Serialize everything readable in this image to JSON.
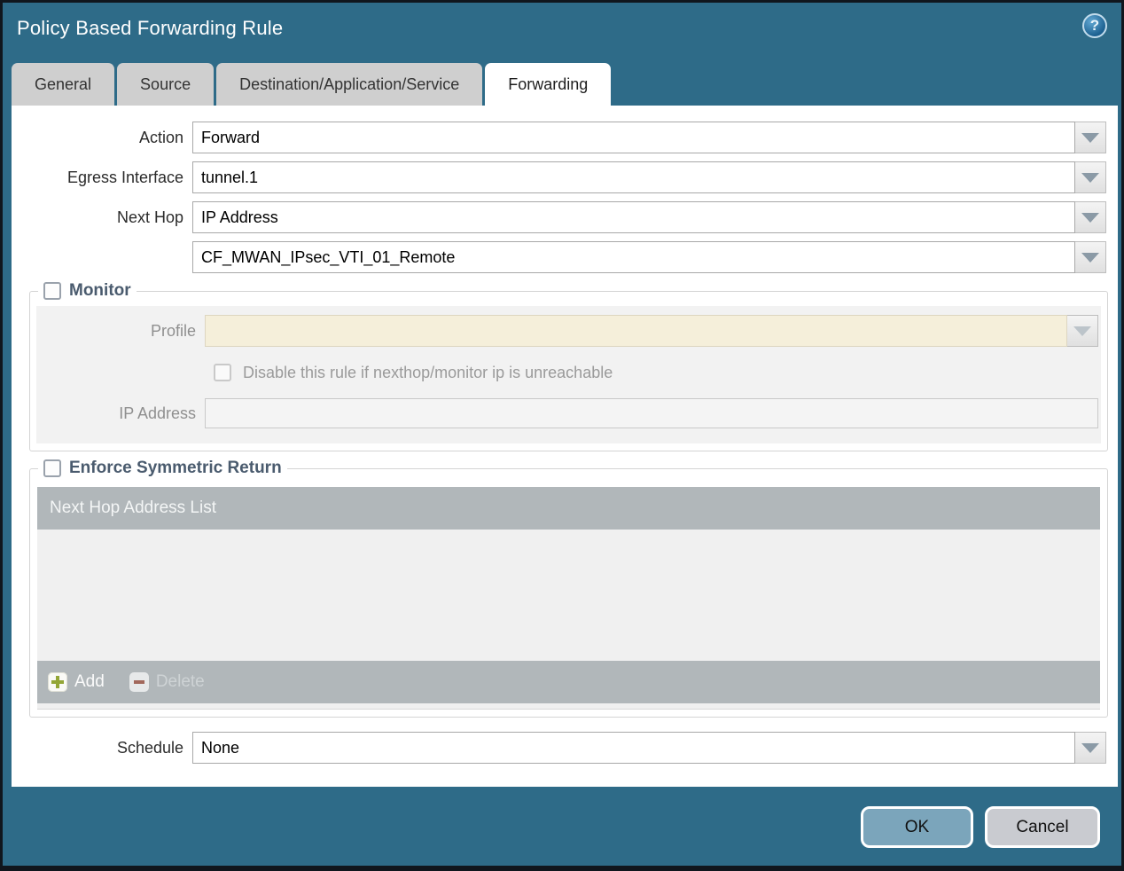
{
  "dialog": {
    "title": "Policy Based Forwarding Rule"
  },
  "icons": {
    "help": "?"
  },
  "tabs": [
    {
      "label": "General",
      "active": false
    },
    {
      "label": "Source",
      "active": false
    },
    {
      "label": "Destination/Application/Service",
      "active": false
    },
    {
      "label": "Forwarding",
      "active": true
    }
  ],
  "form": {
    "action_label": "Action",
    "action_value": "Forward",
    "egress_label": "Egress Interface",
    "egress_value": "tunnel.1",
    "next_hop_label": "Next Hop",
    "next_hop_value": "IP Address",
    "next_hop_address_value": "CF_MWAN_IPsec_VTI_01_Remote",
    "schedule_label": "Schedule",
    "schedule_value": "None"
  },
  "monitor": {
    "legend": "Monitor",
    "checked": false,
    "profile_label": "Profile",
    "profile_value": "",
    "disable_label": "Disable this rule if nexthop/monitor ip is unreachable",
    "disable_checked": false,
    "ip_address_label": "IP Address",
    "ip_address_value": ""
  },
  "symmetric_return": {
    "legend": "Enforce Symmetric Return",
    "checked": false,
    "table_header": "Next Hop Address List",
    "rows": [],
    "add_label": "Add",
    "delete_label": "Delete",
    "delete_enabled": false
  },
  "footer": {
    "ok_label": "OK",
    "cancel_label": "Cancel"
  },
  "colors": {
    "titlebar_teal": "#2e6b88",
    "active_tab_bg": "#ffffff",
    "inactive_tab_bg": "#cfcfcf",
    "table_header_gray": "#b1b7ba",
    "disabled_panel": "#f2f2f2",
    "profile_field_beige": "#f5efda",
    "add_plus_green": "#93a636",
    "delete_minus_red": "#a2685c",
    "ok_button_blue": "#7ba5bb",
    "cancel_button_gray": "#c9cbd0"
  }
}
